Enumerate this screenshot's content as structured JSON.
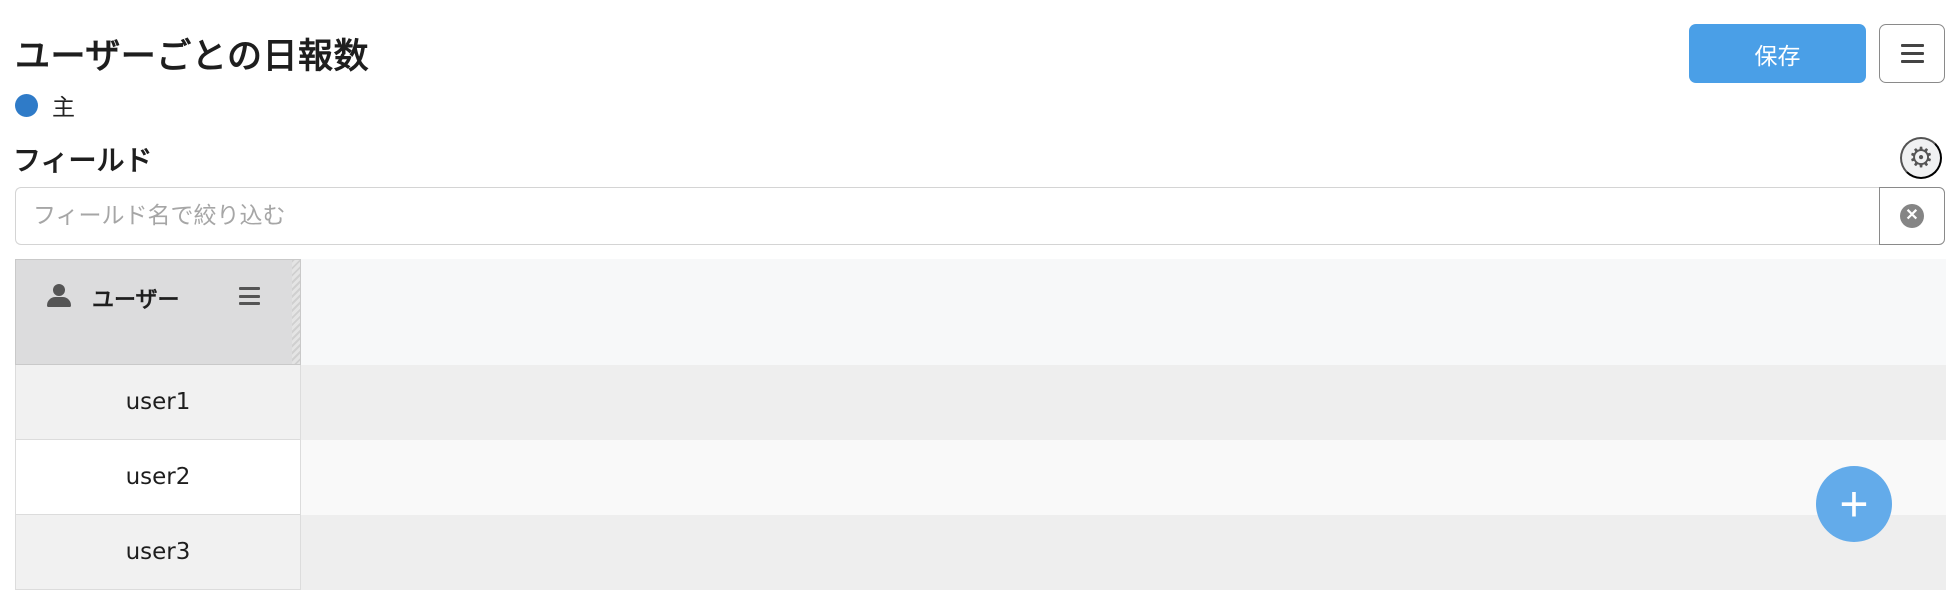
{
  "header": {
    "title": "ユーザーごとの日報数",
    "legend": {
      "label": "主",
      "color": "#2f7bc8"
    },
    "save_label": "保存",
    "menu_icon": "hamburger-icon"
  },
  "fields": {
    "title": "フィールド",
    "settings_icon": "gear-icon",
    "filter": {
      "placeholder": "フィールド名で絞り込む",
      "value": ""
    },
    "clear_icon": "clear-circle-icon"
  },
  "grid": {
    "column": {
      "label": "ユーザー",
      "icon": "user-icon",
      "menu_icon": "hamburger-icon"
    },
    "rows": [
      {
        "label": "user1"
      },
      {
        "label": "user2"
      },
      {
        "label": "user3"
      }
    ]
  },
  "fab": {
    "icon": "plus-icon",
    "glyph": "+"
  },
  "colors": {
    "accent": "#4a9fe7",
    "fab": "#63abea",
    "legend_dot": "#2f7bc8"
  }
}
